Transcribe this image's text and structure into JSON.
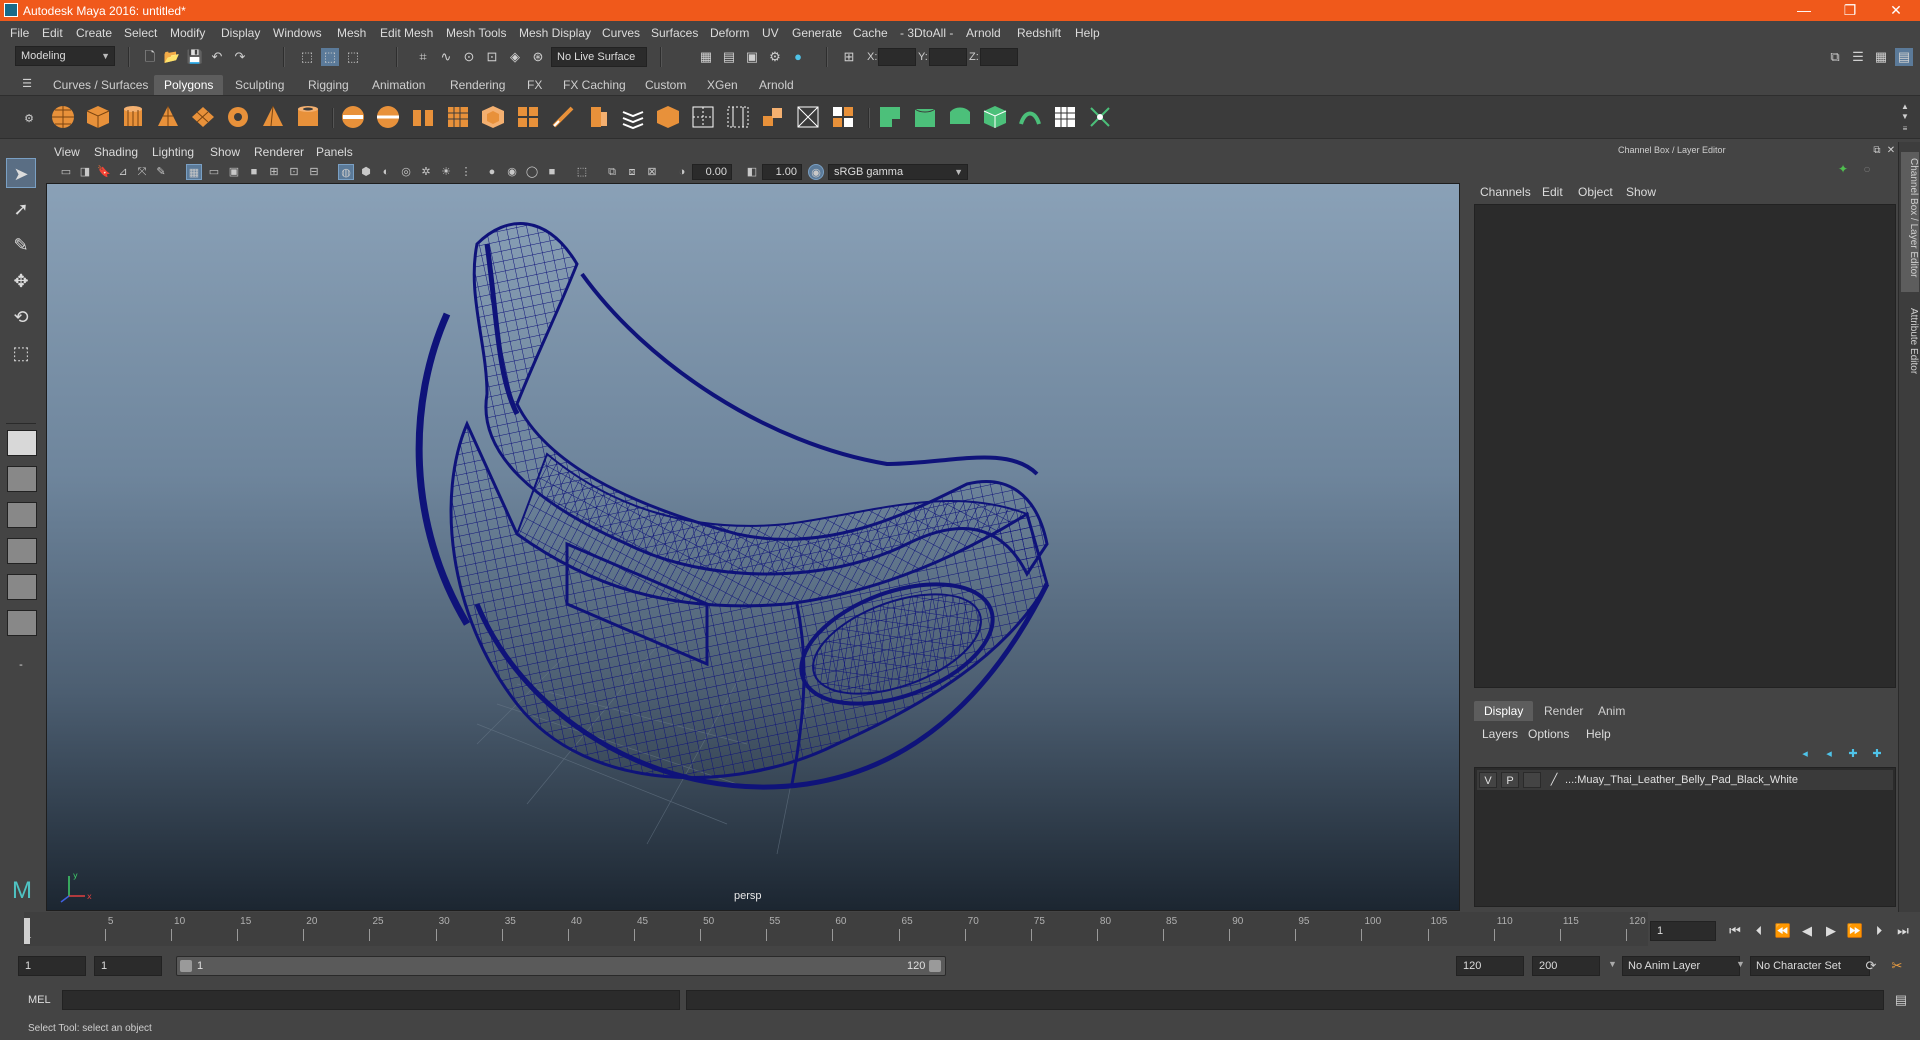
{
  "window": {
    "title": "Autodesk Maya 2016: untitled*",
    "controls": {
      "minimize": "—",
      "maximize": "❐",
      "close": "✕"
    }
  },
  "menubar": [
    "File",
    "Edit",
    "Create",
    "Select",
    "Modify",
    "Display",
    "Windows",
    "Mesh",
    "Edit Mesh",
    "Mesh Tools",
    "Mesh Display",
    "Curves",
    "Surfaces",
    "Deform",
    "UV",
    "Generate",
    "Cache",
    "- 3DtoAll -",
    "Arnold",
    "Redshift",
    "Help"
  ],
  "statusline": {
    "mode": "Modeling",
    "live_surface": "No Live Surface",
    "x_label": "X:",
    "y_label": "Y:",
    "z_label": "Z:"
  },
  "shelf": {
    "tabs": [
      "Curves / Surfaces",
      "Polygons",
      "Sculpting",
      "Rigging",
      "Animation",
      "Rendering",
      "FX",
      "FX Caching",
      "Custom",
      "XGen",
      "Arnold"
    ],
    "active_tab": "Polygons"
  },
  "viewport": {
    "menu": [
      "View",
      "Shading",
      "Lighting",
      "Show",
      "Renderer",
      "Panels"
    ],
    "exposure": "0.00",
    "gamma": "1.00",
    "color_space": "sRGB gamma",
    "camera": "persp",
    "wire_color": "#0f137a"
  },
  "right_panel": {
    "title": "Channel Box / Layer Editor",
    "menu": [
      "Channels",
      "Edit",
      "Object",
      "Show"
    ],
    "tabs": [
      "Display",
      "Render",
      "Anim"
    ],
    "active_tab": "Display",
    "layer_menu": [
      "Layers",
      "Options",
      "Help"
    ],
    "layer": {
      "v": "V",
      "p": "P",
      "name": "...:Muay_Thai_Leather_Belly_Pad_Black_White"
    },
    "side_tabs": [
      "Channel Box / Layer Editor",
      "Attribute Editor"
    ]
  },
  "timeline": {
    "ticks": [
      "5",
      "10",
      "15",
      "20",
      "25",
      "30",
      "35",
      "40",
      "45",
      "50",
      "55",
      "60",
      "65",
      "70",
      "75",
      "80",
      "85",
      "90",
      "95",
      "100",
      "105",
      "110",
      "115",
      "120"
    ],
    "start_label": "1",
    "current_frame": "1"
  },
  "range": {
    "start": "1",
    "start_inner": "1",
    "slider_start": "1",
    "slider_end": "120",
    "end_inner": "120",
    "end": "200",
    "anim_layer": "No Anim Layer",
    "character_set": "No Character Set"
  },
  "cmdline": {
    "label": "MEL"
  },
  "helpline": {
    "text": "Select Tool: select an object"
  }
}
